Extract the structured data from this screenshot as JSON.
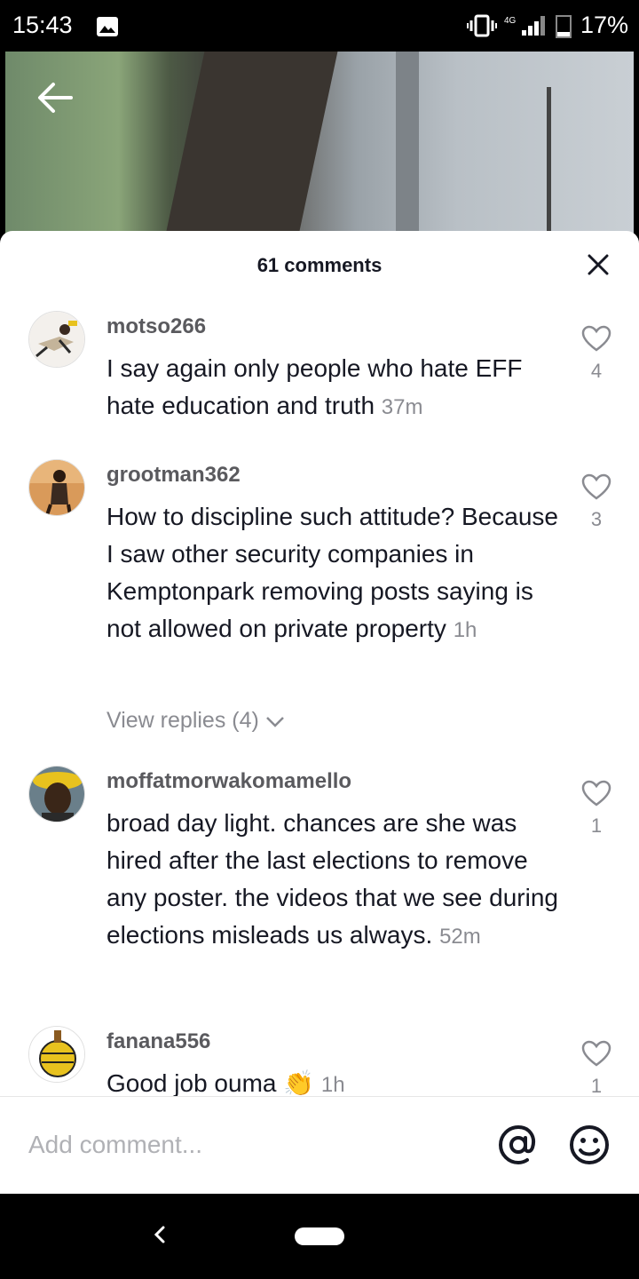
{
  "status_bar": {
    "time": "15:43",
    "network": "4G",
    "battery": "17%",
    "icons": [
      "gallery-icon",
      "vibrate-icon",
      "signal-icon",
      "battery-icon"
    ]
  },
  "sheet": {
    "title": "61 comments"
  },
  "comments": [
    {
      "username": "motso266",
      "text": "I say again only people who hate EFF hate education and truth",
      "time": "37m",
      "likes": "4"
    },
    {
      "username": "grootman362",
      "text": "How to discipline such attitude? Because I saw other security companies in Kemptonpark removing posts saying is not allowed on private property",
      "time": "1h",
      "likes": "3",
      "replies_label": "View replies (4)"
    },
    {
      "username": "moffatmorwakomamello",
      "text": "broad day light. chances are she was hired after the last elections to remove any poster. the videos that we see during elections misleads us always.",
      "time": "52m",
      "likes": "1"
    },
    {
      "username": "fanana556",
      "text": "Good job ouma 👏",
      "time": "1h",
      "likes": "1"
    }
  ],
  "input": {
    "placeholder": "Add comment..."
  },
  "colors": {
    "text": "#161823",
    "muted": "#8a8b91",
    "username": "#5a5a5e"
  }
}
